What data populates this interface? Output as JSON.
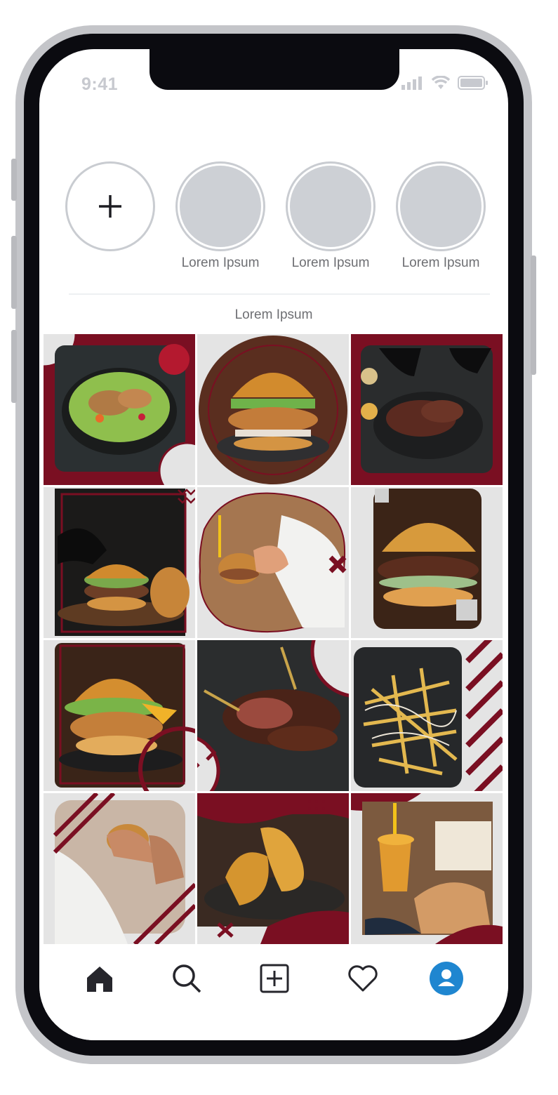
{
  "status_bar": {
    "time": "9:41"
  },
  "stories": {
    "add_icon": "plus-icon",
    "items": [
      {
        "label": "Lorem Ipsum"
      },
      {
        "label": "Lorem Ipsum"
      },
      {
        "label": "Lorem Ipsum"
      }
    ]
  },
  "section": {
    "title": "Lorem Ipsum"
  },
  "grid": {
    "accent_color": "#7a0f22",
    "posts": [
      {
        "subject": "salad bowl",
        "frame": "square"
      },
      {
        "subject": "crispy chicken burger",
        "frame": "circle"
      },
      {
        "subject": "gloved hands with meat",
        "frame": "square"
      },
      {
        "subject": "gloved hand with burger",
        "frame": "outline-square"
      },
      {
        "subject": "hands holding burger",
        "frame": "blob"
      },
      {
        "subject": "pulled pork burger",
        "frame": "rounded"
      },
      {
        "subject": "fried chicken burger",
        "frame": "outline-square"
      },
      {
        "subject": "grilled steak with fork",
        "frame": "none"
      },
      {
        "subject": "loaded fries",
        "frame": "rounded"
      },
      {
        "subject": "person eating burger",
        "frame": "rounded"
      },
      {
        "subject": "fried chicken strips",
        "frame": "wave"
      },
      {
        "subject": "drink and fries on table",
        "frame": "square"
      }
    ]
  },
  "nav": {
    "items": [
      {
        "icon": "home-icon"
      },
      {
        "icon": "search-icon"
      },
      {
        "icon": "add-post-icon"
      },
      {
        "icon": "heart-icon"
      },
      {
        "icon": "profile-icon"
      }
    ],
    "active_color": "#1f86d0"
  }
}
